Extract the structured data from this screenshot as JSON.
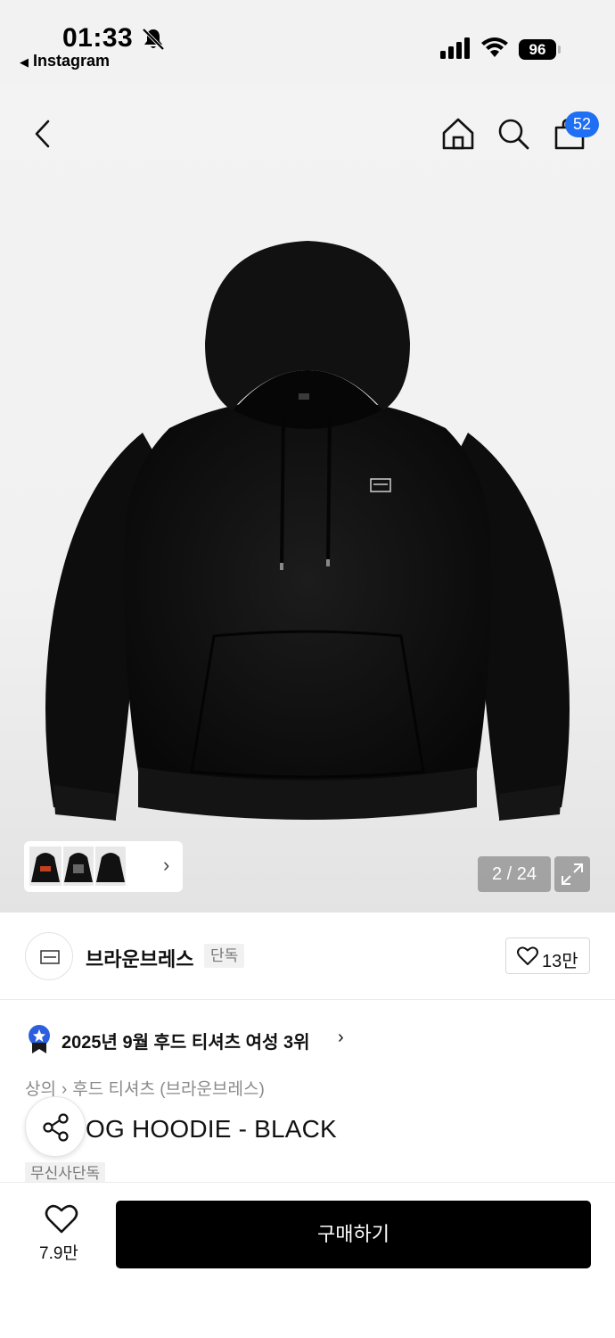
{
  "status_bar": {
    "time": "01:33",
    "back_app": "Instagram",
    "battery": "96"
  },
  "header": {
    "cart_badge": "52"
  },
  "gallery": {
    "page_indicator": "2 / 24",
    "thumbnail_chevron": "›"
  },
  "brand": {
    "name": "브라운브레스",
    "tag": "단독",
    "likes": "13만"
  },
  "ranking": {
    "text": "2025년 9월 후드 티셔츠 여성 3위",
    "chevron": "›"
  },
  "breadcrumb": {
    "category": "상의",
    "separator": "›",
    "subcategory": "후드 티셔츠 (브라운브레스)"
  },
  "product": {
    "title": "OG HOODIE - BLACK",
    "exclusive_tag": "무신사단독"
  },
  "bottom_bar": {
    "wish_count": "7.9만",
    "buy_label": "구매하기"
  },
  "colors": {
    "badge_blue": "#1f6ff5",
    "buy_button": "#000000",
    "muted_text": "#8a8a8a"
  },
  "icons": [
    "bell-slash-icon",
    "signal-icon",
    "wifi-icon",
    "back-arrow-icon",
    "home-icon",
    "search-icon",
    "shopping-bag-icon",
    "expand-icon",
    "heart-icon",
    "ranking-medal-icon",
    "share-icon"
  ]
}
